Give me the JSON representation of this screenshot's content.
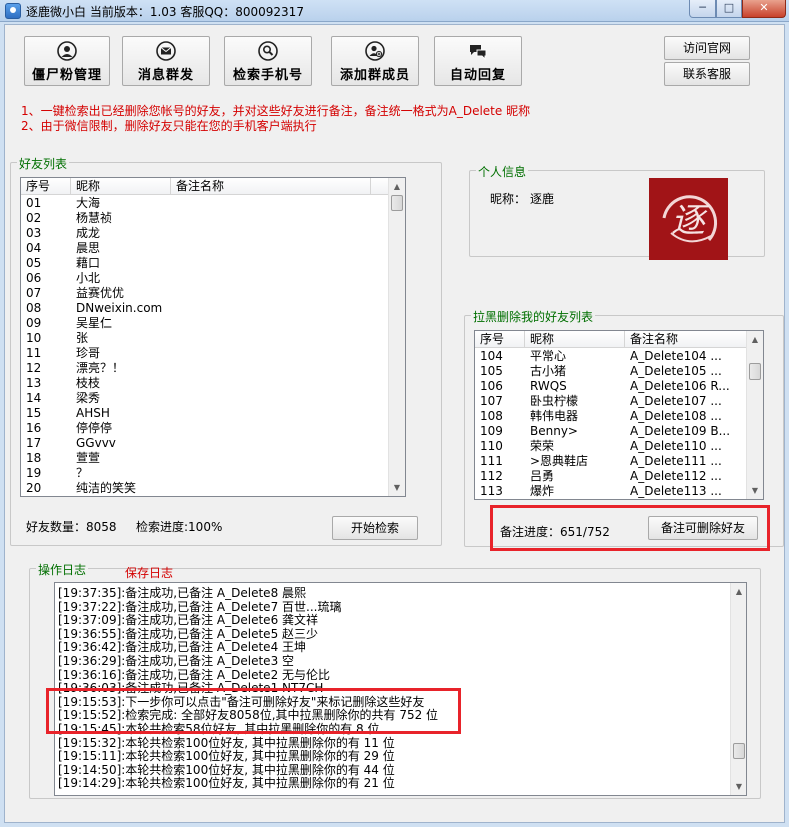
{
  "window": {
    "title": "逐鹿微小白 当前版本：1.03  客服QQ：800092317",
    "min_label": "─",
    "max_label": "□",
    "close_label": "✕"
  },
  "toolbar": [
    {
      "label": "僵尸粉管理",
      "icon": "user-icon"
    },
    {
      "label": "消息群发",
      "icon": "envelope-icon"
    },
    {
      "label": "检索手机号",
      "icon": "search-user-icon"
    },
    {
      "label": "添加群成员",
      "icon": "add-member-icon"
    },
    {
      "label": "自动回复",
      "icon": "chat-bubbles-icon"
    }
  ],
  "links": {
    "visit_site": "访问官网",
    "contact_support": "联系客服"
  },
  "notices": [
    "1、一键检索出已经删除您帐号的好友，并对这些好友进行备注，备注统一格式为A_Delete 昵称",
    "2、由于微信限制，删除好友只能在您的手机客户端执行"
  ],
  "friends": {
    "group_title": "好友列表",
    "columns": [
      "序号",
      "昵称",
      "备注名称"
    ],
    "rows": [
      [
        "01",
        "大海",
        ""
      ],
      [
        "02",
        "杨慧祯",
        ""
      ],
      [
        "03",
        "成龙",
        ""
      ],
      [
        "04",
        "晨思",
        ""
      ],
      [
        "05",
        "藉口",
        ""
      ],
      [
        "06",
        "小北",
        ""
      ],
      [
        "07",
        "益赛优优",
        ""
      ],
      [
        "08",
        "DNweixin.com",
        ""
      ],
      [
        "09",
        "吴星仁",
        ""
      ],
      [
        "10",
        "张",
        ""
      ],
      [
        "11",
        "珍哥",
        ""
      ],
      [
        "12",
        "漂亮？！",
        ""
      ],
      [
        "13",
        "枝枝",
        ""
      ],
      [
        "14",
        "梁秀",
        ""
      ],
      [
        "15",
        "AHSH",
        ""
      ],
      [
        "16",
        "停停停",
        ""
      ],
      [
        "17",
        "GGvvv",
        ""
      ],
      [
        "18",
        "萱萱",
        ""
      ],
      [
        "19",
        "？",
        ""
      ],
      [
        "20",
        "纯洁的笑笑",
        ""
      ]
    ],
    "count_label": "好友数量：8058",
    "progress_label": "检索进度:100%",
    "start_button": "开始检索"
  },
  "profile": {
    "group_title": "个人信息",
    "nickname_label": "昵称：",
    "nickname": "逐鹿",
    "avatar_glyph": "逐"
  },
  "deleted": {
    "group_title": "拉黑删除我的好友列表",
    "columns": [
      "序号",
      "昵称",
      "备注名称"
    ],
    "rows": [
      [
        "104",
        "平常心",
        "A_Delete104  ..."
      ],
      [
        "105",
        "古小猪",
        "A_Delete105  ..."
      ],
      [
        "106",
        "RWQS",
        "A_Delete106  R..."
      ],
      [
        "107",
        "卧虫柠檬",
        "A_Delete107  ..."
      ],
      [
        "108",
        "韩伟电器",
        "A_Delete108  ..."
      ],
      [
        "109",
        "Benny>",
        "A_Delete109  B..."
      ],
      [
        "110",
        "荣荣",
        "A_Delete110  ..."
      ],
      [
        "111",
        ">恩典鞋店",
        "A_Delete111  ..."
      ],
      [
        "112",
        "吕勇",
        "A_Delete112  ..."
      ],
      [
        "113",
        "爆炸",
        "A_Delete113  ..."
      ]
    ],
    "progress_label": "备注进度：651/752",
    "mark_button": "备注可删除好友"
  },
  "log": {
    "group_title": "操作日志",
    "save_label": "保存日志",
    "lines": [
      "[19:37:35]:备注成功,已备注 A_Delete8    晨熙",
      "[19:37:22]:备注成功,已备注 A_Delete7    百世...琉璃",
      "[19:37:09]:备注成功,已备注 A_Delete6    龚文祥",
      "[19:36:55]:备注成功,已备注 A_Delete5    赵三少",
      "[19:36:42]:备注成功,已备注 A_Delete4    王坤",
      "[19:36:29]:备注成功,已备注 A_Delete3    空",
      "[19:36:16]:备注成功,已备注 A_Delete2    无与伦比",
      "[19:36:03]:备注成功,已备注 A_Delete1    NT7CH",
      "[19:15:53]:下一步你可以点击\"备注可删除好友\"来标记删除这些好友",
      "[19:15:52]:检索完成: 全部好友8058位,其中拉黑删除你的共有 752 位",
      "[19:15:45]:本轮共检索58位好友, 其中拉黑删除你的有 8 位",
      "[19:15:32]:本轮共检索100位好友, 其中拉黑删除你的有 11 位",
      "[19:15:11]:本轮共检索100位好友, 其中拉黑删除你的有 29 位",
      "[19:14:50]:本轮共检索100位好友, 其中拉黑删除你的有 44 位",
      "[19:14:29]:本轮共检索100位好友, 其中拉黑删除你的有 21 位"
    ]
  },
  "colors": {
    "notice_text": "#d40000",
    "group_title": "#006f00",
    "highlight_box": "#e8232a",
    "avatar_bg": "#a11417"
  }
}
